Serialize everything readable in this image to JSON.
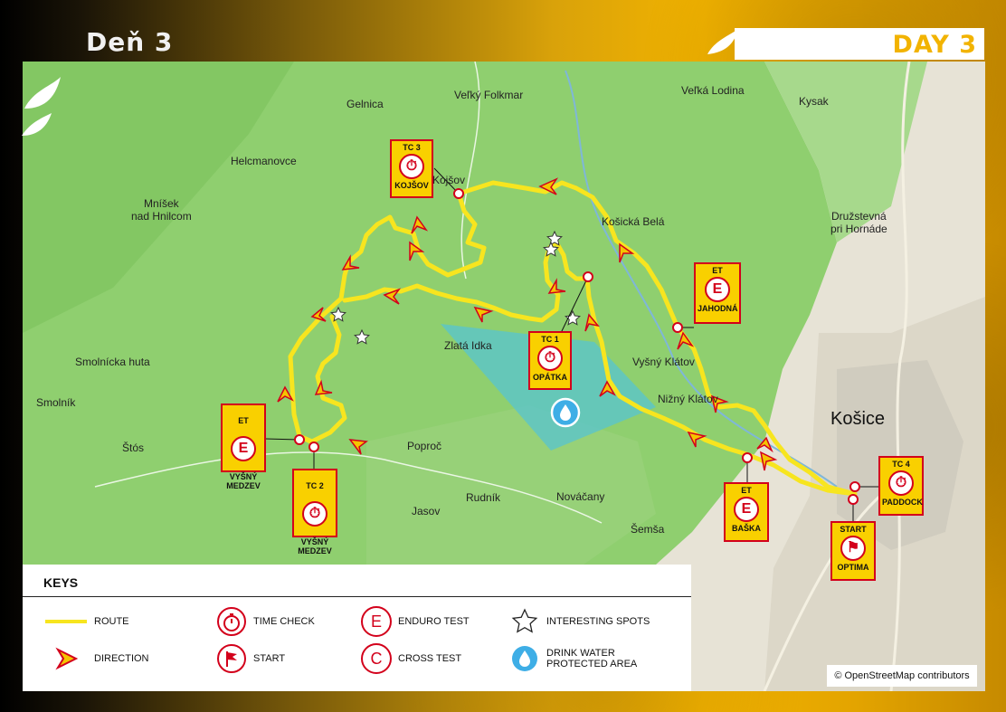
{
  "header": {
    "title_left": "Deň 3",
    "title_right": "DAY 3"
  },
  "colors": {
    "route": "#f7e51f",
    "checkpoint_fill": "#f9d000",
    "checkpoint_border": "#d3001b",
    "forest": "#8fcf6f",
    "water_area": "#5ec6c6",
    "accent_yellow": "#f2b300"
  },
  "places": {
    "gelnica": "Gelnica",
    "velky_folkmar": "Veľký Folkmar",
    "velka_lodina": "Veľká Lodina",
    "kysak": "Kysak",
    "helcmanovce": "Helcmanovce",
    "kojsov": "Kojšov",
    "kosicka_bela": "Košická Belá",
    "mnisek": "Mníšek\nnad Hnilcom",
    "druzstevna": "Družstevná\npri Hornáde",
    "zlata_ida": "Zlatá Idka",
    "vysny_klatov": "Vyšný Klátov",
    "nizny_klatov": "Nižný Klátov",
    "smolnicka_huta": "Smolnícka huta",
    "smolnik": "Smolník",
    "stos": "Štós",
    "kosice": "Košice",
    "poproc": "Poproč",
    "rudnik": "Rudník",
    "jasov": "Jasov",
    "novacany": "Nováčany",
    "semsa": "Šemša"
  },
  "checkpoints": [
    {
      "id": "tc3",
      "type": "TC 3",
      "name": "KOJŠOV",
      "icon": "stopwatch-icon"
    },
    {
      "id": "tc1",
      "type": "TC 1",
      "name": "OPÁTKA",
      "icon": "stopwatch-icon"
    },
    {
      "id": "tc2",
      "type": "TC 2",
      "name": "VYŠNÝ\nMEDZEV",
      "icon": "stopwatch-icon"
    },
    {
      "id": "tc4",
      "type": "TC 4",
      "name": "PADDOCK",
      "icon": "stopwatch-icon"
    },
    {
      "id": "et_jahodna",
      "type": "ET",
      "name": "JAHODNÁ",
      "icon": "E"
    },
    {
      "id": "et_vysny_medzev",
      "type": "ET",
      "name": "VYŠNÝ\nMEDZEV",
      "icon": "E"
    },
    {
      "id": "et_baska",
      "type": "ET",
      "name": "BAŠKA",
      "icon": "E"
    },
    {
      "id": "start",
      "type": "START",
      "name": "OPTIMA",
      "icon": "flag-icon"
    }
  ],
  "keys": {
    "title": "KEYS",
    "route": "ROUTE",
    "direction": "DIRECTION",
    "time_check": "TIME CHECK",
    "start": "START",
    "enduro_test": "ENDURO TEST",
    "cross_test": "CROSS TEST",
    "interesting_spots": "INTERESTING SPOTS",
    "drink_water": "DRINK WATER\nPROTECTED AREA",
    "enduro_letter": "E",
    "cross_letter": "C"
  },
  "attribution": "© OpenStreetMap contributors"
}
